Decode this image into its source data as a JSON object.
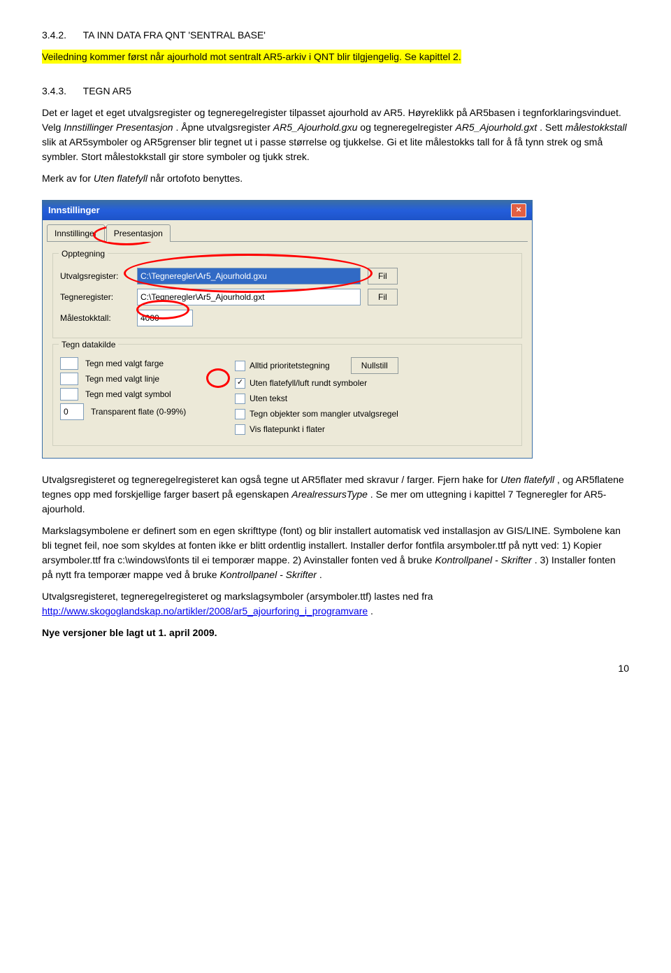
{
  "sections": {
    "s342": {
      "num": "3.4.2.",
      "title": "TA INN DATA FRA QNT 'SENTRAL BASE'",
      "highlight": "Veiledning kommer først når ajourhold mot sentralt AR5-arkiv i QNT blir tilgjengelig. Se kapittel 2."
    },
    "s343": {
      "num": "3.4.3.",
      "title": "TEGN AR5",
      "p1_a": "Det er laget et eget utvalgsregister og tegneregelregister tilpasset ajourhold av AR5. Høyreklikk på AR5basen i tegnforklaringsvinduet. Velg ",
      "p1_i1": "Innstillinger Presentasjon",
      "p1_b": ". Åpne utvalgsregister ",
      "p1_i2": "AR5_Ajourhold.gxu",
      "p1_c": " og tegneregelregister ",
      "p1_i3": "AR5_Ajourhold.gxt",
      "p1_d": ". Sett ",
      "p1_i4": "målestokkstall",
      "p1_e": " slik at AR5symboler og AR5grenser blir tegnet ut i passe størrelse og tjukkelse. Gi et lite målestokks tall for å få tynn strek og små symbler. Stort målestokkstall gir store symboler og tjukk strek.",
      "p2_a": "Merk av for ",
      "p2_i": "Uten flatefyll",
      "p2_b": " når ortofoto benyttes."
    }
  },
  "dialog": {
    "title": "Innstillinger",
    "tabs": {
      "t1": "Innstillinger",
      "t2": "Presentasjon"
    },
    "group1": {
      "label": "Opptegning",
      "row1_label": "Utvalgsregister:",
      "row1_value": "C:\\Tegneregler\\Ar5_Ajourhold.gxu",
      "row2_label": "Tegneregister:",
      "row2_value": "C:\\Tegneregler\\Ar5_Ajourhold.gxt",
      "row3_label": "Målestokktall:",
      "row3_value": "4000",
      "fil_btn": "Fil"
    },
    "group2": {
      "label": "Tegn datakilde",
      "col1": {
        "r1": "Tegn med valgt farge",
        "r2": "Tegn med valgt linje",
        "r3": "Tegn med valgt symbol",
        "r4": "Transparent flate (0-99%)",
        "r4_val": "0"
      },
      "col2": {
        "r1": "Alltid prioritetstegning",
        "r2": "Uten flatefyll/luft rundt symboler",
        "r3": "Uten tekst",
        "r4": "Tegn objekter som mangler utvalgsregel",
        "r5": "Vis flatepunkt i flater"
      },
      "nullstill": "Nullstill"
    }
  },
  "after": {
    "p1_a": "Utvalgsregisteret og tegneregelregisteret kan også tegne ut AR5flater med skravur / farger. Fjern hake for ",
    "p1_i1": "Uten flatefyll",
    "p1_b": ", og AR5flatene tegnes opp med forskjellige farger basert på egenskapen ",
    "p1_i2": "ArealressursType",
    "p1_c": ". Se mer om uttegning i kapittel 7 Tegneregler for AR5-ajourhold.",
    "p2_a": "Markslagsymbolene er definert som en egen skrifttype (font) og blir installert automatisk ved installasjon av GIS/LINE. Symbolene kan bli tegnet feil, noe som skyldes at fonten ikke er blitt ordentlig installert. Installer derfor fontfila arsymboler.ttf på nytt ved: 1) Kopier arsymboler.ttf  fra c:\\windows\\fonts til ei temporær mappe. 2) Avinstaller fonten ved å bruke ",
    "p2_i1": "Kontrollpanel - Skrifter",
    "p2_b": ". 3) Installer fonten på nytt fra temporær mappe ved å bruke ",
    "p2_i2": "Kontrollpanel - Skrifter",
    "p2_c": ".",
    "p3_a": "Utvalgsregisteret, tegneregelregisteret og markslagsymboler (arsymboler.ttf) lastes ned fra ",
    "p3_link": "http://www.skogoglandskap.no/artikler/2008/ar5_ajourforing_i_programvare",
    "p3_b": ".",
    "p4": "Nye versjoner ble lagt ut 1. april 2009."
  },
  "page_num": "10"
}
